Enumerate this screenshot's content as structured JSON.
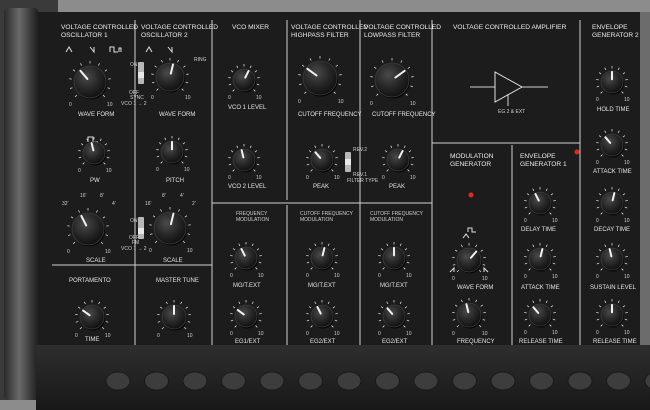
{
  "headers": {
    "vco1": [
      "VOLTAGE CONTROLLED",
      "OSCILLATOR  1"
    ],
    "vco2": [
      "VOLTAGE CONTROLLED",
      "OSCILLATOR  2"
    ],
    "vco_mixer": [
      "VCO MIXER"
    ],
    "hpf": [
      "VOLTAGE CONTROLLED",
      "HIGHPASS FILTER"
    ],
    "lpf": [
      "VOLTAGE CONTROLLED",
      "LOWPASS FILTER"
    ],
    "vca": [
      "VOLTAGE CONTROLLED AMPLIFIER"
    ],
    "eg2": [
      "ENVELOPE",
      "GENERATOR 2"
    ],
    "modgen": [
      "MODULATION",
      "GENERATOR"
    ],
    "eg1": [
      "ENVELOPE",
      "GENERATOR 1"
    ],
    "freqmod": [
      "FREQUENCY",
      "MODULATION"
    ],
    "cutmod1": [
      "CUTOFF FREQUENCY",
      "MODULATION"
    ],
    "cutmod2": [
      "CUTOFF FREQUENCY",
      "MODULATION"
    ]
  },
  "labels": {
    "vco1_waveform": "WAVE FORM",
    "vco2_waveform": "WAVE FORM",
    "pw": "PW",
    "pitch": "PITCH",
    "vco1_scale": "SCALE",
    "vco2_scale": "SCALE",
    "portamento": "PORTAMENTO",
    "master_tune": "MASTER TUNE",
    "time": "TIME",
    "vco1_level": "VCO 1 LEVEL",
    "vco2_level": "VCO 2 LEVEL",
    "hpf_cutoff": "CUTOFF FREQUENCY",
    "lpf_cutoff": "CUTOFF FREQUENCY",
    "hpf_peak": "PEAK",
    "lpf_peak": "PEAK",
    "filter_type": "FILTER TYPE",
    "hold_time": "HOLD TIME",
    "eg2_attack": "ATTACK TIME",
    "decay_time": "DECAY TIME",
    "sustain_level": "SUSTAIN LEVEL",
    "eg2_release": "RELEASE TIME",
    "delay_time": "DELAY TIME",
    "eg1_attack": "ATTACK TIME",
    "eg1_release": "RELEASE TIME",
    "mod_waveform": "WAVE FORM",
    "mod_frequency": "FREQUENCY",
    "fm_mgt": "MG/T.EXT",
    "fm_eg1": "EG1/EXT",
    "hpm_mgt": "MG/T.EXT",
    "hpm_eg2": "EG2/EXT",
    "lpm_mgt": "MG/T.EXT",
    "lpm_eg2": "EG2/EXT",
    "vca_source": "EG 2 & EXT"
  },
  "switches": {
    "sync_on": "ON",
    "sync_off": "OFF",
    "sync_label": "SYNC",
    "sync_route": "VCO 1 → 2",
    "fm_on": "ON",
    "fm_off": "OFF",
    "fm_label": "FM",
    "fm_route": "VCO 1 → 2",
    "rev2": "REV.2",
    "rev1": "REV.1",
    "ring": "RING"
  },
  "scales": {
    "vco_scale": [
      "32'",
      "16'",
      "8'",
      "4'"
    ],
    "vco2_scale": [
      "16'",
      "8'",
      "4'",
      "2'"
    ],
    "bipolar": [
      "-5",
      "-3",
      "-1",
      "0",
      "+1",
      "+3",
      "+5"
    ],
    "unipolar_min": "0",
    "unipolar_max": "10",
    "cutoff_min": "0",
    "cutoff_max": "10"
  },
  "led_color": "#e02a1a",
  "panel_color": "#1c1c1c",
  "label_color": "#e6e6e6"
}
